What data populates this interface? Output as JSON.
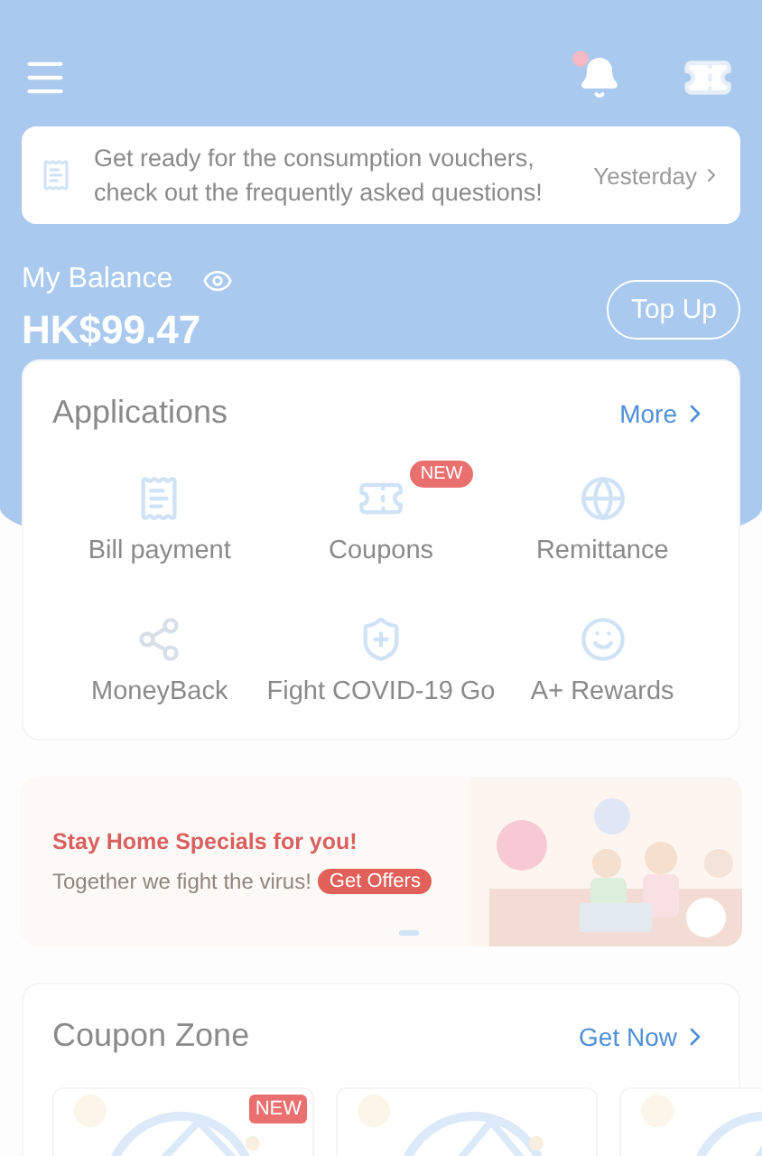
{
  "header": {
    "notification_dot": true
  },
  "notice": {
    "text": "Get ready for the consumption vouchers, check out the frequently asked questions!",
    "time": "Yesterday"
  },
  "balance": {
    "label": "My Balance",
    "amount": "HK$99.47",
    "top_up": "Top Up"
  },
  "applications": {
    "title": "Applications",
    "more": "More",
    "items": [
      {
        "label": "Bill payment"
      },
      {
        "label": "Coupons",
        "badge": "NEW"
      },
      {
        "label": "Remittance"
      },
      {
        "label": "MoneyBack"
      },
      {
        "label": "Fight COVID-19 Go"
      },
      {
        "label": "A+ Rewards"
      }
    ]
  },
  "banner": {
    "title": "Stay Home Specials for you!",
    "subtitle": "Together we fight the virus!",
    "button": "Get Offers"
  },
  "coupon_zone": {
    "title": "Coupon Zone",
    "link": "Get Now",
    "coupons": [
      {
        "kind": "picture",
        "badge": "NEW"
      },
      {
        "kind": "picture"
      },
      {
        "kind": "picture"
      }
    ]
  }
}
